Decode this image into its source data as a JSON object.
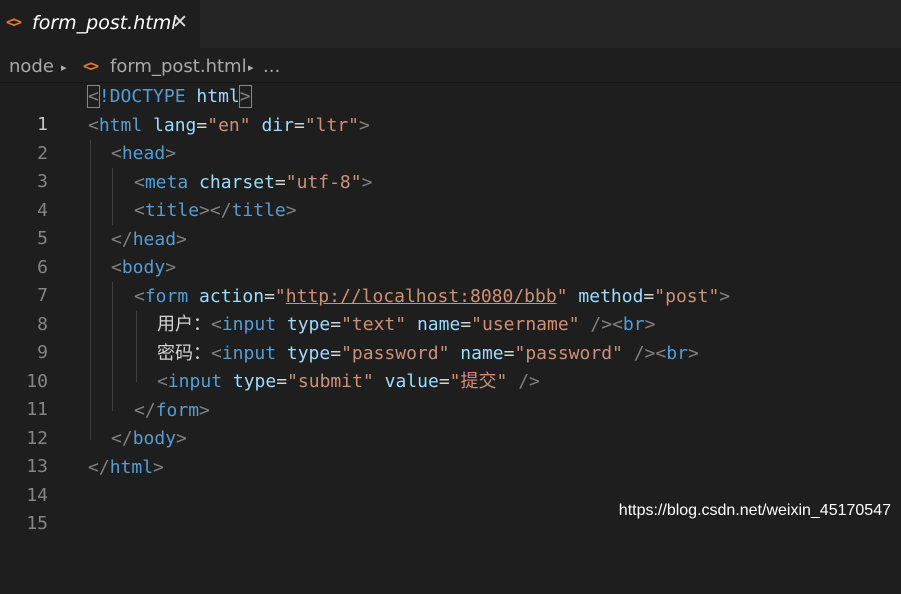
{
  "tab": {
    "icon": "<>",
    "title": "form_post.html",
    "close": "✕"
  },
  "breadcrumb": {
    "items": [
      "node",
      "form_post.html",
      "..."
    ],
    "icon": "<>",
    "separator": "▸"
  },
  "editor": {
    "lines": [
      {
        "n": "1"
      },
      {
        "n": "2"
      },
      {
        "n": "3"
      },
      {
        "n": "4"
      },
      {
        "n": "5"
      },
      {
        "n": "6"
      },
      {
        "n": "7"
      },
      {
        "n": "8"
      },
      {
        "n": "9"
      },
      {
        "n": "10"
      },
      {
        "n": "11"
      },
      {
        "n": "12"
      },
      {
        "n": "13"
      },
      {
        "n": "14"
      },
      {
        "n": "15"
      }
    ],
    "tokens": {
      "doctype_open": "<",
      "doctype_kw": "!DOCTYPE",
      "doctype_html": "html",
      "doctype_close": ">",
      "lt": "<",
      "gt": ">",
      "close_lt": "</",
      "selfclose": "/>",
      "eq": "=",
      "tag_html": "html",
      "tag_head": "head",
      "tag_meta": "meta",
      "tag_title": "title",
      "tag_body": "body",
      "tag_form": "form",
      "tag_input": "input",
      "tag_br": "br",
      "attr_lang": "lang",
      "attr_dir": "dir",
      "attr_charset": "charset",
      "attr_action": "action",
      "attr_method": "method",
      "attr_type": "type",
      "attr_name": "name",
      "attr_value": "value",
      "val_en": "\"en\"",
      "val_ltr": "\"ltr\"",
      "val_utf8": "\"utf-8\"",
      "val_action_q": "\"",
      "val_action_url": "http://localhost:8080/bbb",
      "val_post": "\"post\"",
      "val_text": "\"text\"",
      "val_username": "\"username\"",
      "val_password": "\"password\"",
      "val_submit": "\"submit\"",
      "val_tijiao": "\"提交\"",
      "text_user": "用户：",
      "text_pwd": "密码："
    }
  },
  "watermark": "https://blog.csdn.net/weixin_45170547"
}
